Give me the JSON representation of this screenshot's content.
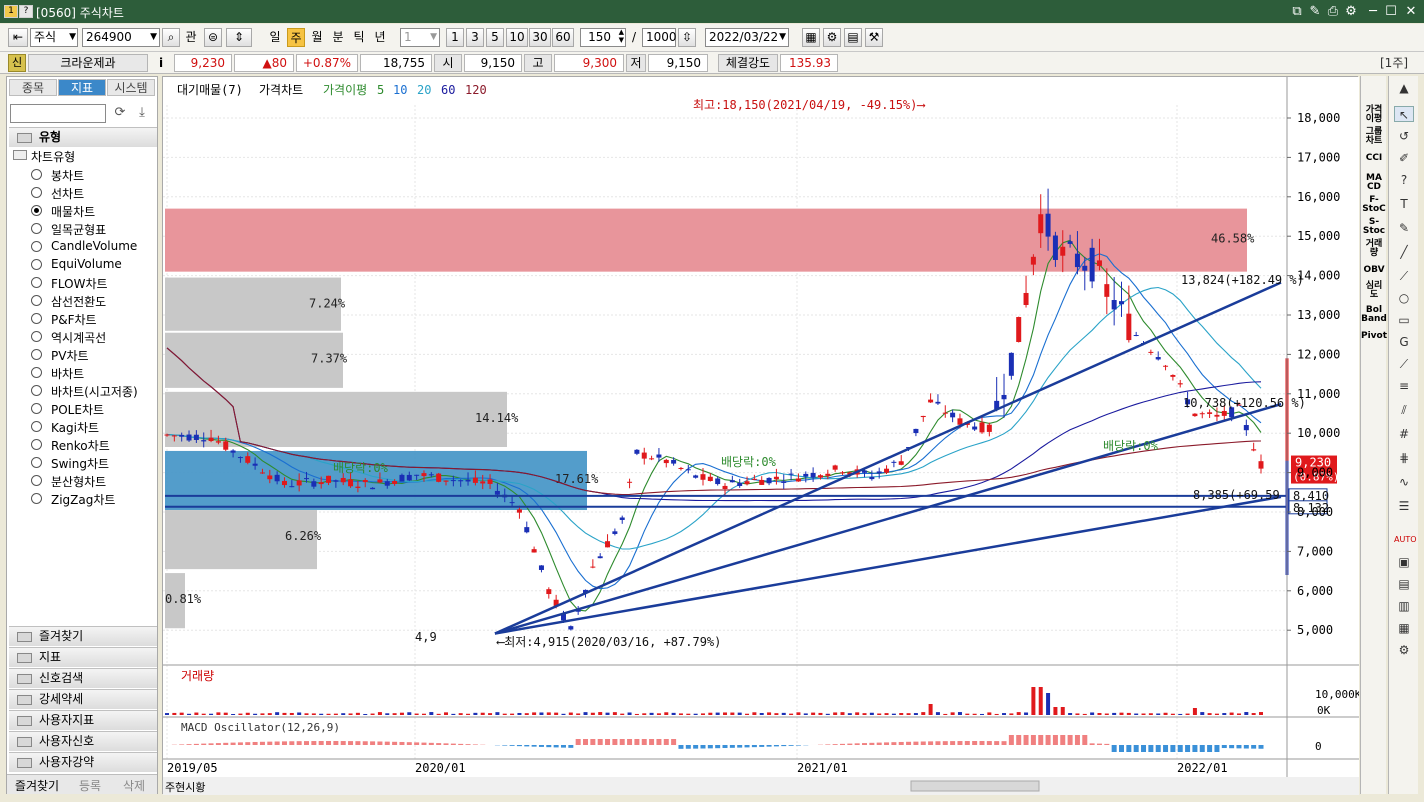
{
  "window": {
    "title": "[0560] 주식차트",
    "badges": [
      "1",
      "?"
    ]
  },
  "toolbar": {
    "market": "주식",
    "code": "264900",
    "gwan": "관",
    "periods": [
      "일",
      "주",
      "월",
      "분",
      "틱",
      "년"
    ],
    "active_period": "주",
    "interval_select": "1",
    "quick_intervals": [
      "1",
      "3",
      "5",
      "10",
      "30",
      "60"
    ],
    "count": "150",
    "slash": "/",
    "total": "1000",
    "date": "2022/03/22"
  },
  "quote": {
    "sin": "신",
    "name": "크라운제과",
    "info": "i",
    "price": "9,230",
    "change": "▲80",
    "change_pct": "+0.87%",
    "volume": "18,755",
    "open_label": "시",
    "open": "9,150",
    "high_label": "고",
    "high": "9,300",
    "low_label": "저",
    "low": "9,150",
    "strength_label": "체결강도",
    "strength": "135.93",
    "unit": "[1주]"
  },
  "left": {
    "tabs": [
      "종목",
      "지표",
      "시스템"
    ],
    "active_tab": "지표",
    "group": "유형",
    "category": "차트유형",
    "chart_types": [
      "봉차트",
      "선차트",
      "매물차트",
      "일목균형표",
      "CandleVolume",
      "EquiVolume",
      "FLOW차트",
      "삼선전환도",
      "P&F차트",
      "역시계곡선",
      "PV차트",
      "바차트",
      "바차트(시고저종)",
      "POLE차트",
      "Kagi차트",
      "Renko차트",
      "Swing차트",
      "분산형차트",
      "ZigZag차트"
    ],
    "selected_type": "매물차트",
    "sections": [
      "즐겨찾기",
      "지표",
      "신호검색",
      "강세약세",
      "사용자지표",
      "사용자신호",
      "사용자강약"
    ],
    "bottom_tabs": [
      "즐겨찾기",
      "등록",
      "삭제"
    ]
  },
  "chart": {
    "legend": {
      "vol_profile": "대기매물(7)",
      "price": "가격차트",
      "ma_label": "가격이평",
      "ma_periods": [
        "5",
        "10",
        "20",
        "60",
        "120"
      ]
    },
    "ma_colors": {
      "ma5": "#2e8b2e",
      "ma10": "#1a6fd1",
      "ma20": "#2aa3c8",
      "ma60": "#1a1a9e",
      "ma120": "#8b1a2a"
    },
    "price_axis": [
      "18,000",
      "17,000",
      "16,000",
      "15,000",
      "14,000",
      "13,000",
      "12,000",
      "11,000",
      "10,000",
      "9,000",
      "8,000",
      "7,000",
      "6,000",
      "5,000"
    ],
    "date_axis": [
      "2019/05",
      "2020/01",
      "2021/01",
      "2022/01"
    ],
    "annotations": {
      "high": "최고:18,150(2021/04/19, -49.15%)⟶",
      "low": "⟵최저:4,915(2020/03/16, +87.79%)",
      "low_left": "4,9",
      "dividend1": "배당락:0%",
      "dividend2": "배당락:0%",
      "dividend3": "배당락:0%",
      "line1": "13,824(+182.49 %)",
      "line2": "10,738(+120.56 %)",
      "line3": "8,385(+69.59 %)",
      "price_tag": "9,230",
      "price_tag_pct": "(0.87%)",
      "tag_8410": "8,410",
      "tag_8132": "8,132"
    },
    "volume_profile": [
      {
        "label": "46.58%",
        "color": "#e8959b"
      },
      {
        "label": "7.24%",
        "color": "#c8c8c8"
      },
      {
        "label": "7.37%",
        "color": "#c8c8c8"
      },
      {
        "label": "14.14%",
        "color": "#c8c8c8"
      },
      {
        "label": "17.61%",
        "color": "#4a98c8"
      },
      {
        "label": "6.26%",
        "color": "#c8c8c8"
      },
      {
        "label": "0.81%",
        "color": "#c8c8c8"
      }
    ],
    "volume_title": "거래량",
    "volume_axis": [
      "10,000K",
      "0K"
    ],
    "macd_title": "MACD Oscillator(12,26,9)",
    "macd_axis": "0",
    "bottom_btns": [
      "주",
      "현",
      "시",
      "황"
    ]
  },
  "rightbar": {
    "indicators": [
      "가격\n이평",
      "그룹\n차트",
      "CCI",
      "MA\nCD",
      "F-\nStoC",
      "S-\nStoc",
      "거래\n량",
      "OBV",
      "심리\n도",
      "Bol\nBand",
      "Pivot"
    ]
  }
}
